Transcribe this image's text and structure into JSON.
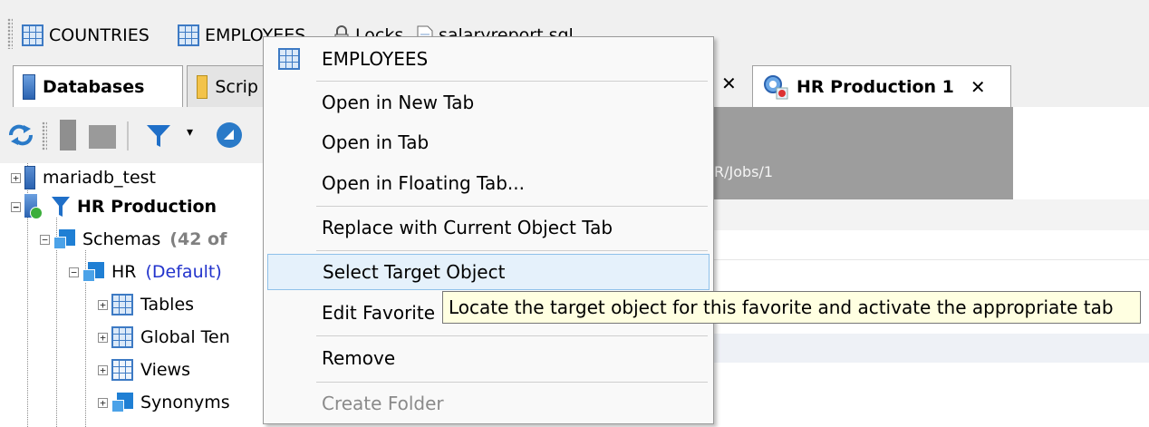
{
  "favorites_bar": {
    "items": [
      {
        "label": "COUNTRIES",
        "icon": "table-icon"
      },
      {
        "label": "EMPLOYEES",
        "icon": "table-icon"
      },
      {
        "label": "Locks",
        "icon": "lock-icon"
      },
      {
        "label": "salaryreport.sql",
        "icon": "sql-file-icon"
      }
    ]
  },
  "tabs": [
    {
      "label": "Databases",
      "icon": "database-icon",
      "active": true
    },
    {
      "label": "Scrip",
      "icon": "script-icon",
      "active": false
    },
    {
      "label": "HR Production 1",
      "icon": "connection-icon",
      "active": true,
      "close": "✕"
    }
  ],
  "hidden_tab_close": "✕",
  "tree": {
    "nodes": [
      {
        "label": "mariadb_test",
        "level": 0,
        "expander": "+"
      },
      {
        "label": "HR Production",
        "level": 0,
        "expander": "−",
        "bold": true
      },
      {
        "label": "Schemas",
        "count": "(42 of",
        "level": 1,
        "expander": "−"
      },
      {
        "label": "HR",
        "suffix": "(Default)",
        "level": 2,
        "expander": "−"
      },
      {
        "label": "Tables",
        "level": 3,
        "expander": "+"
      },
      {
        "label": "Global Ten",
        "level": 3,
        "expander": "+"
      },
      {
        "label": "Views",
        "level": 3,
        "expander": "+"
      },
      {
        "label": "Synonyms",
        "level": 3,
        "expander": "+"
      }
    ]
  },
  "content": {
    "path_fragment": "R/Jobs/1"
  },
  "context_menu": {
    "header": "EMPLOYEES",
    "items": [
      {
        "label": "Open in New Tab"
      },
      {
        "label": "Open in Tab"
      },
      {
        "label": "Open in Floating Tab..."
      },
      {
        "label": "Replace with Current Object Tab"
      },
      {
        "label": "Select Target Object",
        "highlighted": true
      },
      {
        "label": "Edit Favorite"
      },
      {
        "label": "Remove"
      },
      {
        "label": "Create Folder",
        "disabled": true
      }
    ]
  },
  "tooltip": {
    "text": "Locate the target object for this favorite and activate the appropriate tab"
  },
  "colors": {
    "accent": "#3d7ac4",
    "menu_highlight": "#e5f1fb",
    "tooltip_bg": "#ffffe1",
    "funnel": "#1f6fc8"
  }
}
